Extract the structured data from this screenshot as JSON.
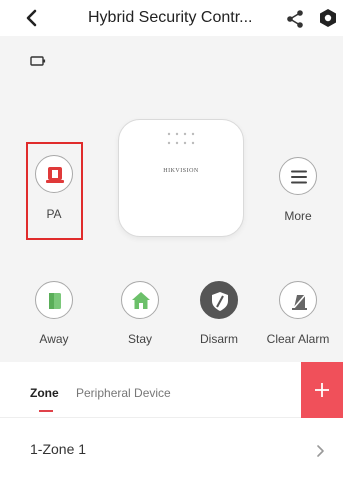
{
  "header": {
    "title": "Hybrid Security Contr..."
  },
  "device": {
    "brand": "HIKVISION"
  },
  "actions": {
    "pa_label": "PA",
    "more_label": "More",
    "away_label": "Away",
    "stay_label": "Stay",
    "disarm_label": "Disarm",
    "clear_alarm_label": "Clear Alarm"
  },
  "tabs": [
    {
      "label": "Zone",
      "active": true
    },
    {
      "label": "Peripheral Device",
      "active": false
    }
  ],
  "zones": [
    {
      "label": "1-Zone 1"
    }
  ],
  "icons": {
    "back": "back-arrow-icon",
    "share": "share-icon",
    "settings": "hexagon-settings-icon",
    "battery": "battery-icon",
    "pa": "panic-alarm-icon",
    "more": "menu-icon",
    "away": "door-icon",
    "stay": "home-icon",
    "disarm": "shield-icon",
    "clear_alarm": "clear-alarm-icon",
    "add": "plus-icon",
    "chevron": "chevron-right-icon"
  },
  "colors": {
    "accent_red": "#e0424a",
    "add_button": "#f0505a",
    "highlight_border": "#e02b2b",
    "away_green": "#7bc87a",
    "stay_green": "#6cc06a",
    "disarm_dark": "#555555"
  }
}
